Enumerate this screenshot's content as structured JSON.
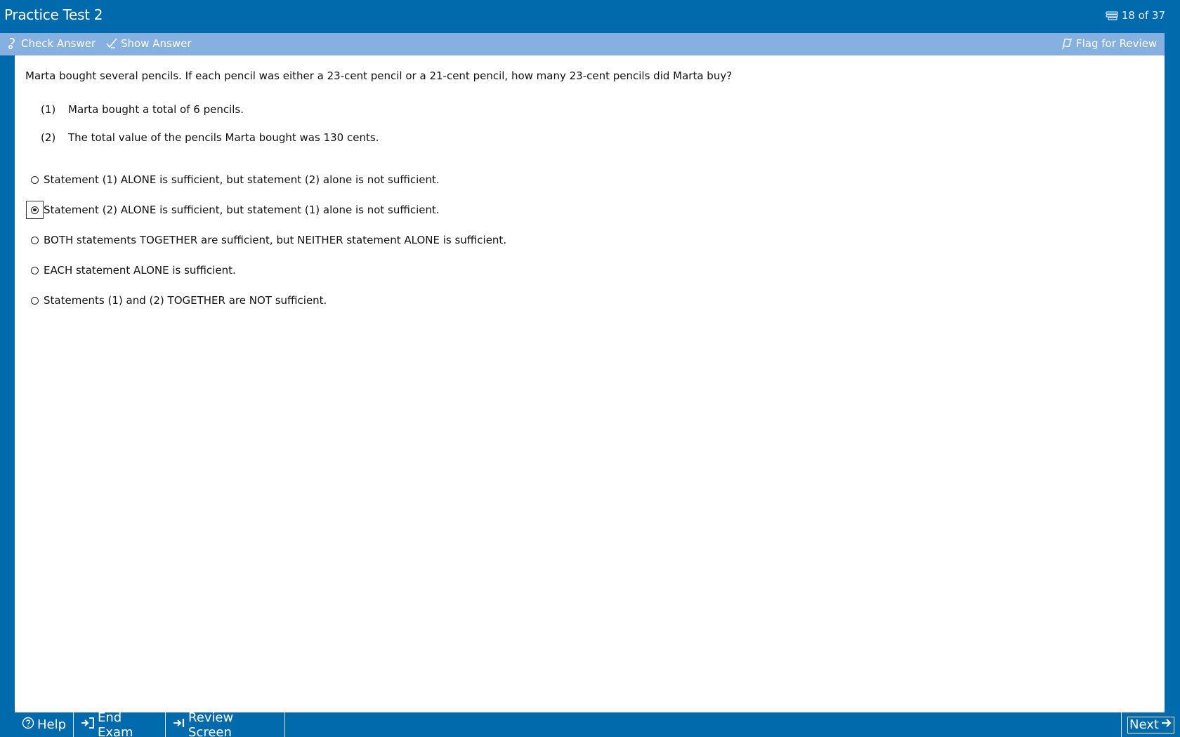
{
  "header": {
    "title": "Practice Test 2",
    "counter": "18 of 37",
    "counter_icon": "stack-icon"
  },
  "toolbar": {
    "check_answer": "Check Answer",
    "show_answer": "Show Answer",
    "flag_for_review": "Flag for Review"
  },
  "question": {
    "stem": "Marta bought several pencils.  If each pencil was either a 23-cent pencil or a 21-cent pencil, how many 23-cent pencils did Marta buy?",
    "statements": [
      {
        "num": "(1)",
        "text": "Marta bought a total of 6 pencils."
      },
      {
        "num": "(2)",
        "text": "The total value of the pencils Marta bought was 130 cents."
      }
    ],
    "choices": [
      {
        "text": "Statement (1) ALONE is sufficient, but statement (2) alone is not sufficient.",
        "selected": false
      },
      {
        "text": "Statement (2) ALONE is sufficient, but statement (1) alone is not sufficient.",
        "selected": true
      },
      {
        "text": "BOTH statements TOGETHER are sufficient, but NEITHER statement ALONE is sufficient.",
        "selected": false
      },
      {
        "text": "EACH statement ALONE is sufficient.",
        "selected": false
      },
      {
        "text": "Statements (1) and (2) TOGETHER are NOT sufficient.",
        "selected": false
      }
    ]
  },
  "footer": {
    "help": "Help",
    "end_exam": "End Exam",
    "review_screen": "Review Screen",
    "next": "Next"
  },
  "colors": {
    "frame": "#006aac",
    "toolbar": "#86b0e0",
    "content": "#ffffff"
  }
}
